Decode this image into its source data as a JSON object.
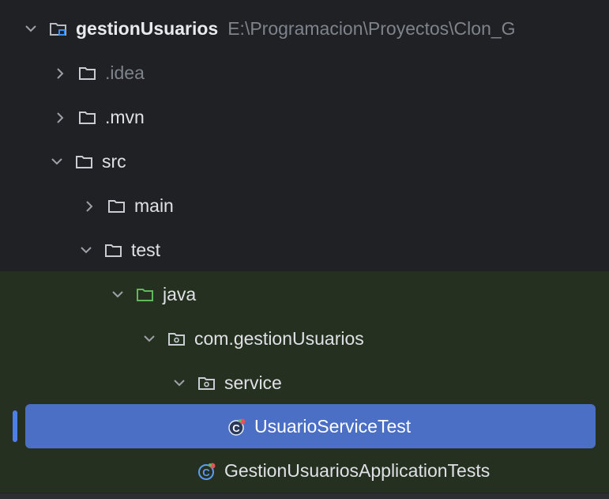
{
  "project_tree": {
    "root": {
      "name": "gestionUsuarios",
      "path": "E:\\Programacion\\Proyectos\\Clon_G"
    },
    "items": [
      {
        "label": ".idea"
      },
      {
        "label": ".mvn"
      },
      {
        "label": "src"
      },
      {
        "label": "main"
      },
      {
        "label": "test"
      },
      {
        "label": "java"
      },
      {
        "label": "com.gestionUsuarios"
      },
      {
        "label": "service"
      },
      {
        "label": "UsuarioServiceTest"
      },
      {
        "label": "GestionUsuariosApplicationTests"
      }
    ],
    "selected": "UsuarioServiceTest"
  },
  "colors": {
    "background": "#1f2124",
    "test_scope_background": "#253021",
    "selection": "#4a6fc4",
    "test_folder_icon": "#5fb85b",
    "class_icon": "#5a9cf5"
  }
}
